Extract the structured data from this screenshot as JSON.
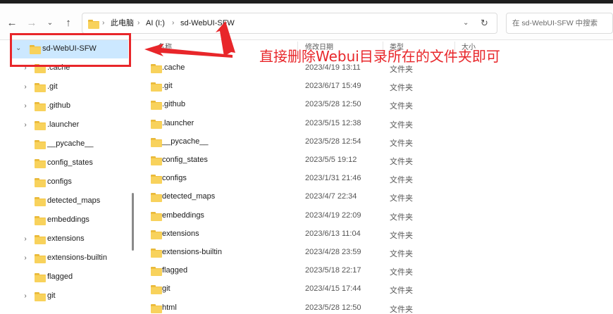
{
  "window": {
    "title": "sd-WebUI-SFW"
  },
  "toolbar": {
    "back_icon": "back-arrow-icon",
    "forward_icon": "forward-arrow-icon",
    "recent_icon": "chevron-down-icon",
    "up_icon": "up-arrow-icon",
    "breadcrumb": [
      "此电脑",
      "AI (I:)",
      "sd-WebUI-SFW"
    ],
    "search_placeholder": "在 sd-WebUI-SFW 中搜索"
  },
  "sidebar": {
    "root": {
      "label": "sd-WebUI-SFW",
      "expanded": true
    },
    "items": [
      {
        "label": ".cache",
        "has_children": true
      },
      {
        "label": ".git",
        "has_children": true
      },
      {
        "label": ".github",
        "has_children": true
      },
      {
        "label": ".launcher",
        "has_children": true
      },
      {
        "label": "__pycache__",
        "has_children": false
      },
      {
        "label": "config_states",
        "has_children": false
      },
      {
        "label": "configs",
        "has_children": false
      },
      {
        "label": "detected_maps",
        "has_children": false
      },
      {
        "label": "embeddings",
        "has_children": false
      },
      {
        "label": "extensions",
        "has_children": true
      },
      {
        "label": "extensions-builtin",
        "has_children": true
      },
      {
        "label": "flagged",
        "has_children": false
      },
      {
        "label": "git",
        "has_children": true
      }
    ]
  },
  "columns": {
    "name": "名称",
    "date": "修改日期",
    "type": "类型",
    "size": "大小"
  },
  "files": [
    {
      "name": ".cache",
      "date": "2023/4/19 13:11",
      "type": "文件夹"
    },
    {
      "name": ".git",
      "date": "2023/6/17 15:49",
      "type": "文件夹"
    },
    {
      "name": ".github",
      "date": "2023/5/28 12:50",
      "type": "文件夹"
    },
    {
      "name": ".launcher",
      "date": "2023/5/15 12:38",
      "type": "文件夹"
    },
    {
      "name": "__pycache__",
      "date": "2023/5/28 12:54",
      "type": "文件夹"
    },
    {
      "name": "config_states",
      "date": "2023/5/5 19:12",
      "type": "文件夹"
    },
    {
      "name": "configs",
      "date": "2023/1/31 21:46",
      "type": "文件夹"
    },
    {
      "name": "detected_maps",
      "date": "2023/4/7 22:34",
      "type": "文件夹"
    },
    {
      "name": "embeddings",
      "date": "2023/4/19 22:09",
      "type": "文件夹"
    },
    {
      "name": "extensions",
      "date": "2023/6/13 11:04",
      "type": "文件夹"
    },
    {
      "name": "extensions-builtin",
      "date": "2023/4/28 23:59",
      "type": "文件夹"
    },
    {
      "name": "flagged",
      "date": "2023/5/18 22:17",
      "type": "文件夹"
    },
    {
      "name": "git",
      "date": "2023/4/15 17:44",
      "type": "文件夹"
    },
    {
      "name": "html",
      "date": "2023/5/28 12:50",
      "type": "文件夹"
    }
  ],
  "annotation": {
    "text": "直接删除Webui目录所在的文件夹即可",
    "color": "#e8262a"
  },
  "colors": {
    "selection": "#cce8ff",
    "folder": "#f8d25c",
    "accent_red": "#e8262a"
  }
}
